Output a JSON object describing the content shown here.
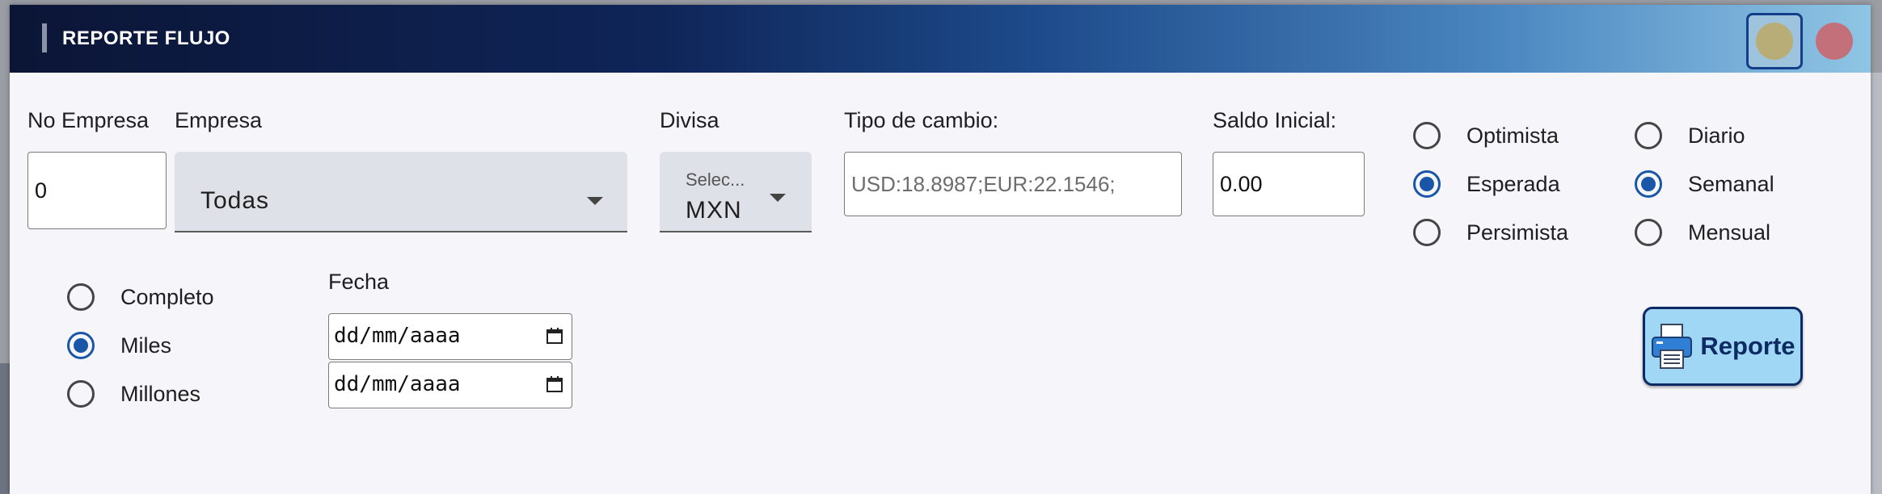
{
  "window": {
    "title": "REPORTE FLUJO"
  },
  "form": {
    "no_empresa": {
      "label": "No Empresa",
      "value": "0"
    },
    "empresa": {
      "label": "Empresa",
      "value": "Todas"
    },
    "divisa": {
      "label": "Divisa",
      "hint": "Selec...",
      "value": "MXN"
    },
    "tipo_cambio": {
      "label": "Tipo de cambio:",
      "value": "USD:18.8987;EUR:22.1546;"
    },
    "saldo_inicial": {
      "label": "Saldo Inicial:",
      "value": "0.00"
    },
    "escenario": {
      "options": [
        {
          "label": "Optimista",
          "selected": false
        },
        {
          "label": "Esperada",
          "selected": true
        },
        {
          "label": "Persimista",
          "selected": false
        }
      ]
    },
    "periodo": {
      "options": [
        {
          "label": "Diario",
          "selected": false
        },
        {
          "label": "Semanal",
          "selected": true
        },
        {
          "label": "Mensual",
          "selected": false
        }
      ]
    },
    "unidades": {
      "options": [
        {
          "label": "Completo",
          "selected": false
        },
        {
          "label": "Miles",
          "selected": true
        },
        {
          "label": "Millones",
          "selected": false
        }
      ]
    },
    "fecha": {
      "label": "Fecha",
      "desde_placeholder": "dd/mm/aaaa",
      "hasta_placeholder": "dd/mm/aaaa"
    }
  },
  "actions": {
    "reporte_label": "Reporte"
  },
  "colors": {
    "accent": "#1a56a8",
    "button_bg": "#9fd7f5",
    "button_border": "#0c2a66"
  },
  "icons": {
    "report": "printer-icon",
    "calendar": "calendar-icon",
    "minimize": "minimize-dot-icon",
    "close": "close-dot-icon"
  }
}
